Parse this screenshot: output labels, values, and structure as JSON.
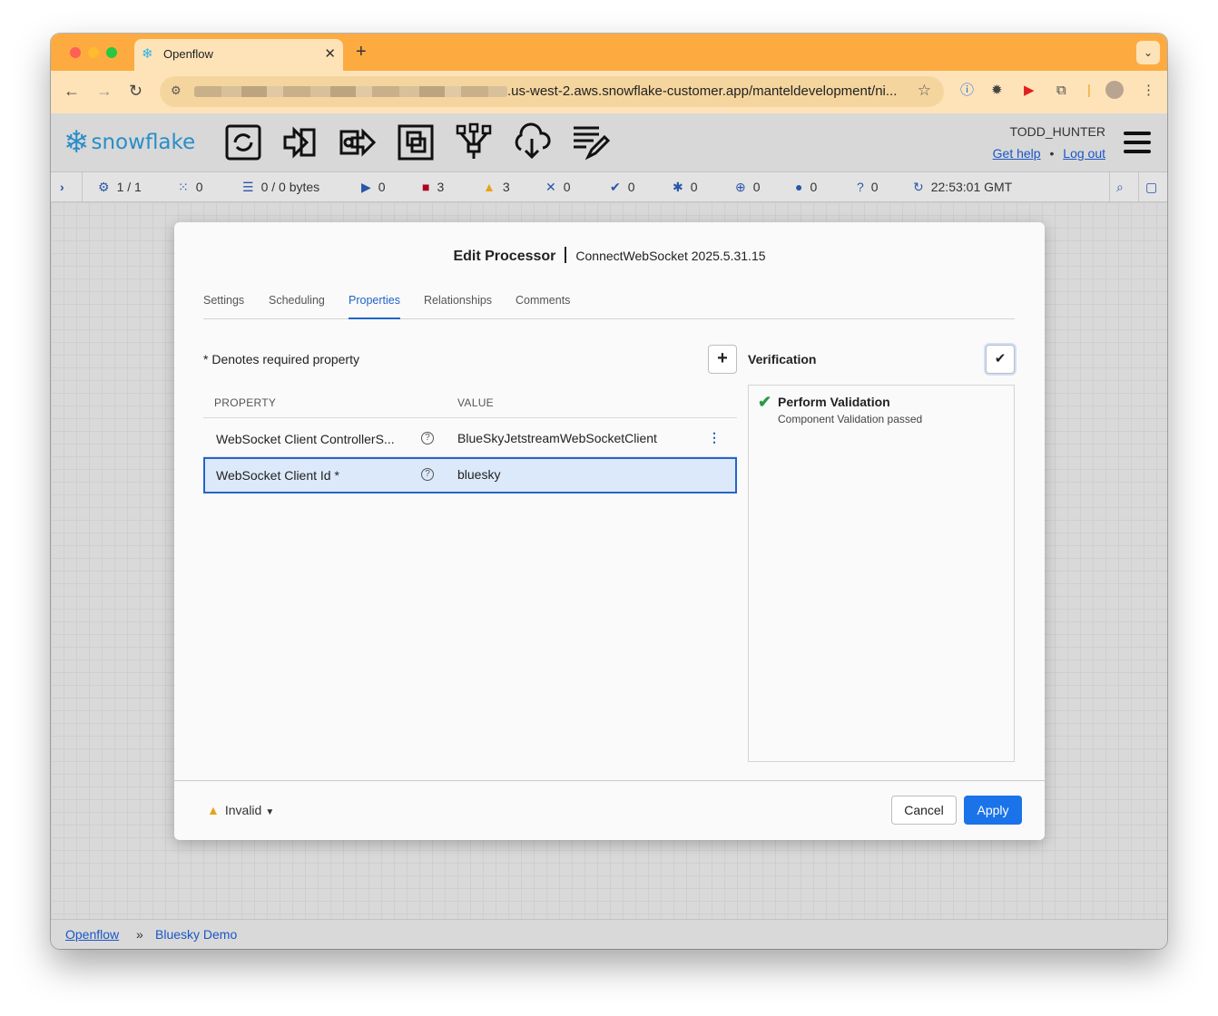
{
  "browser": {
    "tab_title": "Openflow",
    "url_visible": ".us-west-2.aws.snowflake-customer.app/manteldevelopment/ni...",
    "new_tab": "+",
    "tab_close": "✕"
  },
  "header": {
    "logo_text": "snowflake",
    "user": "TODD_HUNTER",
    "get_help": "Get help",
    "separator": "•",
    "log_out": "Log out",
    "toolbar_icons": [
      "processor-icon",
      "input-port-icon",
      "output-port-icon",
      "process-group-icon",
      "remote-process-group-icon",
      "funnel-icon",
      "template-icon",
      "label-icon"
    ]
  },
  "status_bar": {
    "items": [
      {
        "icon": "cluster-icon",
        "value": "1 / 1"
      },
      {
        "icon": "thread-icon",
        "value": "0"
      },
      {
        "icon": "queue-icon",
        "value": "0 / 0 bytes"
      },
      {
        "icon": "running-icon",
        "value": "0"
      },
      {
        "icon": "stopped-icon",
        "value": "3"
      },
      {
        "icon": "invalid-icon",
        "value": "3"
      },
      {
        "icon": "disabled-icon",
        "value": "0"
      },
      {
        "icon": "up-to-date-icon",
        "value": "0"
      },
      {
        "icon": "locally-modified-icon",
        "value": "0"
      },
      {
        "icon": "stale-icon",
        "value": "0"
      },
      {
        "icon": "modified-stale-icon",
        "value": "0"
      },
      {
        "icon": "sync-failure-icon",
        "value": "0"
      }
    ],
    "refresh_time": "22:53:01 GMT"
  },
  "dialog": {
    "title": "Edit Processor",
    "subtitle": "ConnectWebSocket 2025.5.31.15",
    "tabs": [
      "Settings",
      "Scheduling",
      "Properties",
      "Relationships",
      "Comments"
    ],
    "active_tab": "Properties",
    "required_note": "* Denotes required property",
    "add_button": "+",
    "columns": {
      "property": "PROPERTY",
      "value": "VALUE"
    },
    "properties": [
      {
        "name": "WebSocket Client ControllerS...",
        "value": "BlueSkyJetstreamWebSocketClient"
      },
      {
        "name": "WebSocket Client Id *",
        "value": "bluesky"
      }
    ],
    "help_glyph": "?",
    "verification": {
      "title": "Verification",
      "check_glyph": "✔",
      "result_name": "Perform Validation",
      "result_desc": "Component Validation passed"
    },
    "status": "Invalid",
    "cancel": "Cancel",
    "apply": "Apply"
  },
  "breadcrumb": {
    "root": "Openflow",
    "sep": "»",
    "current": "Bluesky Demo"
  },
  "colors": {
    "tab_strip": "#fdab41",
    "accent": "#1a73e8",
    "selected_row": "#dce9fb",
    "snowflake_blue": "#2a8dc8"
  }
}
